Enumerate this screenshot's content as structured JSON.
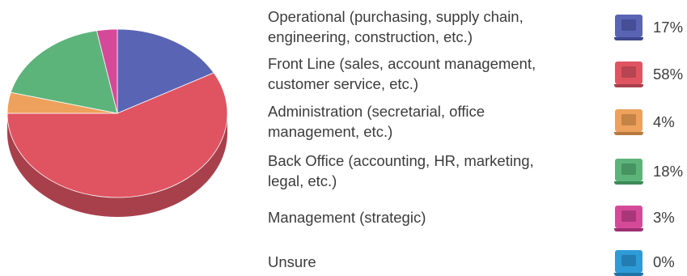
{
  "chart_data": {
    "type": "pie",
    "title": "",
    "categories": [
      "Operational (purchasing, supply chain, engineering, construction, etc.)",
      "Front Line (sales, account management, customer service, etc.)",
      "Administration (secretarial, office management, etc.)",
      "Back Office (accounting, HR, marketing, legal, etc.)",
      "Management (strategic)",
      "Unsure"
    ],
    "label_lines": [
      [
        "Operational (purchasing, supply chain,",
        "engineering, construction, etc.)"
      ],
      [
        "Front Line (sales, account management,",
        "customer service, etc.)"
      ],
      [
        "Administration (secretarial, office",
        "management, etc.)"
      ],
      [
        "Back Office (accounting, HR, marketing,",
        "legal, etc.)"
      ],
      [
        "Management (strategic)"
      ],
      [
        "Unsure"
      ]
    ],
    "values": [
      17,
      58,
      4,
      18,
      3,
      0
    ],
    "value_labels": [
      "17%",
      "58%",
      "4%",
      "18%",
      "3%",
      "0%"
    ],
    "colors": [
      "#5a64b4",
      "#e05462",
      "#eda15c",
      "#5db47a",
      "#d44a98",
      "#2e9bd6"
    ],
    "side_colors": [
      "#3f478c",
      "#a8404c",
      "#b7793f",
      "#3f8a59",
      "#9c3070",
      "#1f74a6"
    ],
    "legend_placement": "right",
    "style": "3d-pie"
  }
}
